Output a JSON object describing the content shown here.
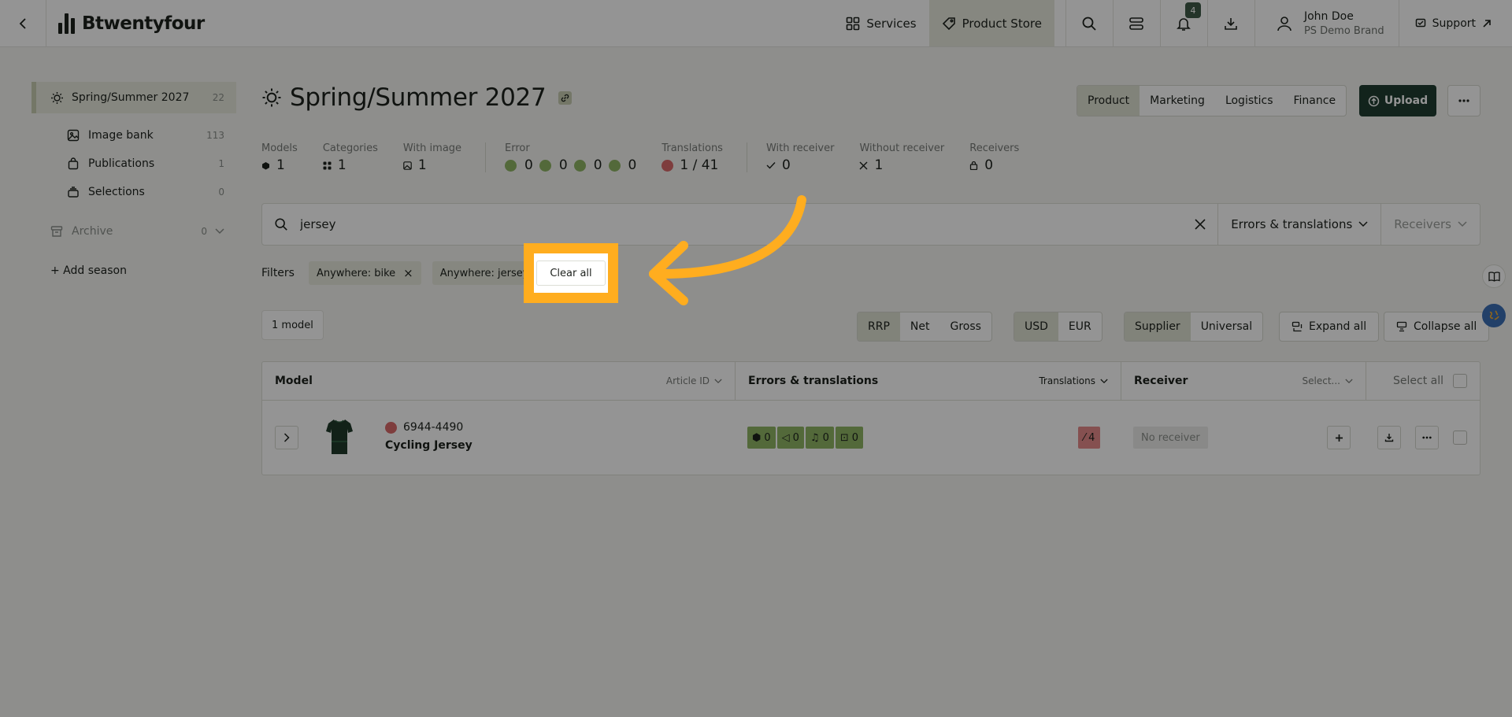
{
  "app": {
    "name": "Btwentyfour",
    "nav_services": "Services",
    "nav_product_store": "Product Store",
    "notification_count": "4",
    "user_name": "John Doe",
    "user_brand": "PS Demo Brand",
    "support": "Support"
  },
  "sidebar": {
    "season": {
      "label": "Spring/Summer 2027",
      "count": "22"
    },
    "items": [
      {
        "label": "Image bank",
        "count": "113",
        "icon": "image-icon"
      },
      {
        "label": "Publications",
        "count": "1",
        "icon": "bag-icon"
      },
      {
        "label": "Selections",
        "count": "0",
        "icon": "stack-icon"
      }
    ],
    "archive": {
      "label": "Archive",
      "count": "0"
    },
    "add_season": "+ Add season"
  },
  "header": {
    "title": "Spring/Summer 2027",
    "tabs": [
      "Product",
      "Marketing",
      "Logistics",
      "Finance"
    ],
    "active_tab": "Product",
    "upload": "Upload"
  },
  "stats": {
    "models": {
      "label": "Models",
      "value": "1"
    },
    "categories": {
      "label": "Categories",
      "value": "1"
    },
    "with_image": {
      "label": "With image",
      "value": "1"
    },
    "error": {
      "label": "Error",
      "values": [
        "0",
        "0",
        "0",
        "0"
      ]
    },
    "translations": {
      "label": "Translations",
      "value": "1 / 41"
    },
    "with_receiver": {
      "label": "With receiver",
      "value": "0"
    },
    "without_receiver": {
      "label": "Without receiver",
      "value": "1"
    },
    "receivers": {
      "label": "Receivers",
      "value": "0"
    }
  },
  "search": {
    "value": "jersey",
    "dropdown_errors": "Errors & translations",
    "dropdown_receivers": "Receivers"
  },
  "filters": {
    "label": "Filters",
    "chips": [
      "Anywhere: bike",
      "Anywhere: jersey"
    ],
    "clear_all": "Clear all"
  },
  "toolbar": {
    "model_count": "1 model",
    "price_options": [
      "RRP",
      "Net",
      "Gross"
    ],
    "currency_options": [
      "USD",
      "EUR"
    ],
    "mode_options": [
      "Supplier",
      "Universal"
    ],
    "expand_all": "Expand all",
    "collapse_all": "Collapse all"
  },
  "table": {
    "headers": {
      "model": "Model",
      "article_id": "Article ID",
      "errors": "Errors & translations",
      "translations": "Translations",
      "receiver": "Receiver",
      "receiver_select": "Select...",
      "select_all": "Select all"
    },
    "rows": [
      {
        "article_id": "6944-4490",
        "name": "Cycling Jersey",
        "errors": [
          "0",
          "0",
          "0",
          "0"
        ],
        "translations_missing": "4",
        "receiver": "No receiver"
      }
    ]
  },
  "colors": {
    "accent_dark": "#1f3d31",
    "highlight": "#ffad1f",
    "ok_green": "#8fb564",
    "error_red": "#e58b8b"
  }
}
